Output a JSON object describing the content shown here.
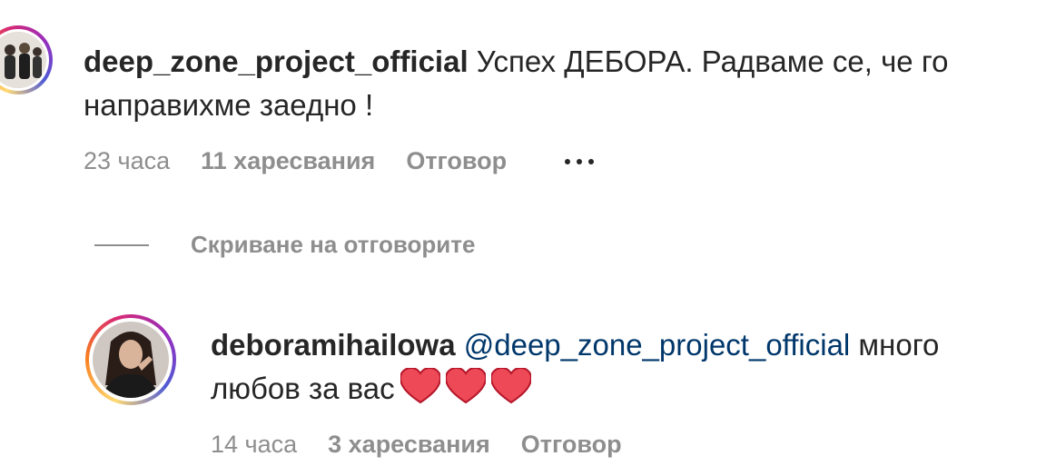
{
  "colors": {
    "text": "#262626",
    "meta": "#8e8e8e",
    "mention": "#00376b",
    "heart": "#ed4956"
  },
  "comment": {
    "username": "deep_zone_project_official",
    "text": " Успех ДЕБОРА. Радваме се, че го направихме заедно !",
    "time": "23 часа",
    "likes": "11 харесвания",
    "reply": "Отговор",
    "more_icon": "more-options-icon"
  },
  "replies_toggle": {
    "label": "Скриване на отговорите"
  },
  "reply": {
    "username": "deboramihailowa",
    "mention": "@deep_zone_project_official",
    "text": " много любов за вас",
    "hearts": [
      "heart-icon",
      "heart-icon",
      "heart-icon"
    ],
    "time": "14 часа",
    "likes": "3 харесвания",
    "reply": "Отговор"
  }
}
